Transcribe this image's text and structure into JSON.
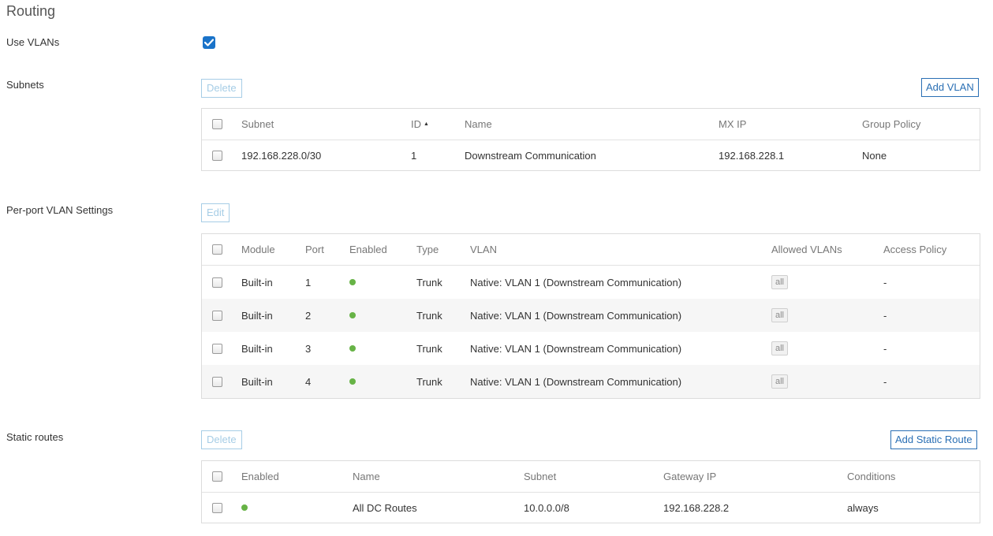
{
  "page": {
    "title": "Routing"
  },
  "use_vlans": {
    "label": "Use VLANs",
    "checked": true
  },
  "subnets": {
    "label": "Subnets",
    "delete_label": "Delete",
    "add_label": "Add VLAN",
    "columns": [
      "Subnet",
      "ID",
      "Name",
      "MX IP",
      "Group Policy"
    ],
    "sort_icon": "▲",
    "rows": [
      {
        "subnet": "192.168.228.0/30",
        "id": "1",
        "name": "Downstream Communication",
        "mx_ip": "192.168.228.1",
        "group_policy": "None"
      }
    ]
  },
  "per_port": {
    "label": "Per-port VLAN Settings",
    "edit_label": "Edit",
    "columns": [
      "Module",
      "Port",
      "Enabled",
      "Type",
      "VLAN",
      "Allowed VLANs",
      "Access Policy"
    ],
    "rows": [
      {
        "module": "Built-in",
        "port": "1",
        "type": "Trunk",
        "vlan": "Native: VLAN 1 (Downstream Communication)",
        "allowed": "all",
        "access": "-"
      },
      {
        "module": "Built-in",
        "port": "2",
        "type": "Trunk",
        "vlan": "Native: VLAN 1 (Downstream Communication)",
        "allowed": "all",
        "access": "-"
      },
      {
        "module": "Built-in",
        "port": "3",
        "type": "Trunk",
        "vlan": "Native: VLAN 1 (Downstream Communication)",
        "allowed": "all",
        "access": "-"
      },
      {
        "module": "Built-in",
        "port": "4",
        "type": "Trunk",
        "vlan": "Native: VLAN 1 (Downstream Communication)",
        "allowed": "all",
        "access": "-"
      }
    ]
  },
  "static_routes": {
    "label": "Static routes",
    "delete_label": "Delete",
    "add_label": "Add Static Route",
    "columns": [
      "Enabled",
      "Name",
      "Subnet",
      "Gateway IP",
      "Conditions"
    ],
    "rows": [
      {
        "name": "All DC Routes",
        "subnet": "10.0.0.0/8",
        "gateway": "192.168.228.2",
        "conditions": "always"
      }
    ]
  },
  "colors": {
    "accent": "#2a6fb4",
    "checkbox_blue": "#1a73c9",
    "enabled_green": "#67b346",
    "disabled_button": "#a6cde6"
  }
}
